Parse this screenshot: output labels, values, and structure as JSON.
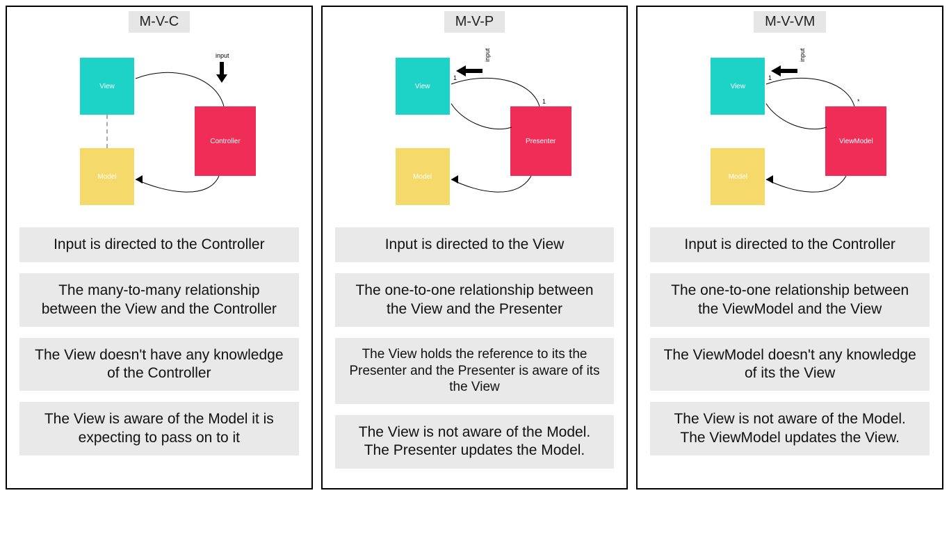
{
  "colors": {
    "view": "#1dd3c7",
    "model": "#f6d96b",
    "controller": "#ef2d56",
    "card_bg": "#e9e9e9"
  },
  "panels": [
    {
      "id": "mvc",
      "title": "M-V-C",
      "diagram": {
        "view_label": "View",
        "model_label": "Model",
        "controller_label": "Controller",
        "input_label": "input",
        "input_target": "controller",
        "view_controller_cardinality": "many-to-many",
        "view_end_marker": "*",
        "ctl_end_marker": "*",
        "view_model_link": "dashed"
      },
      "cards": [
        "Input is directed to the Controller",
        "The many-to-many relationship between the View and the Controller",
        "The View doesn't have any knowledge of the Controller",
        "The View is aware of the Model it is expecting to pass on to it"
      ]
    },
    {
      "id": "mvp",
      "title": "M-V-P",
      "diagram": {
        "view_label": "View",
        "model_label": "Model",
        "controller_label": "Presenter",
        "input_label": "input",
        "input_target": "view",
        "view_controller_cardinality": "one-to-one",
        "view_end_marker": "1",
        "ctl_end_marker": "1",
        "view_model_link": "via-presenter"
      },
      "cards": [
        "Input is directed to the View",
        "The one-to-one relationship between the View and the Presenter",
        "The View holds the reference to its the Presenter and the Presenter is aware of its the View",
        "The View is not aware of the Model. The Presenter updates the Model."
      ]
    },
    {
      "id": "mvvm",
      "title": "M-V-VM",
      "diagram": {
        "view_label": "View",
        "model_label": "Model",
        "controller_label": "ViewModel",
        "input_label": "input",
        "input_target": "view",
        "view_controller_cardinality": "one-to-one",
        "view_end_marker": "1",
        "ctl_end_marker": "*",
        "view_model_link": "via-viewmodel"
      },
      "cards": [
        "Input is directed to the Controller",
        "The one-to-one relationship between the ViewModel and the View",
        "The ViewModel doesn't any knowledge of its the View",
        "The View is not aware of the Model. The ViewModel updates the View."
      ]
    }
  ]
}
